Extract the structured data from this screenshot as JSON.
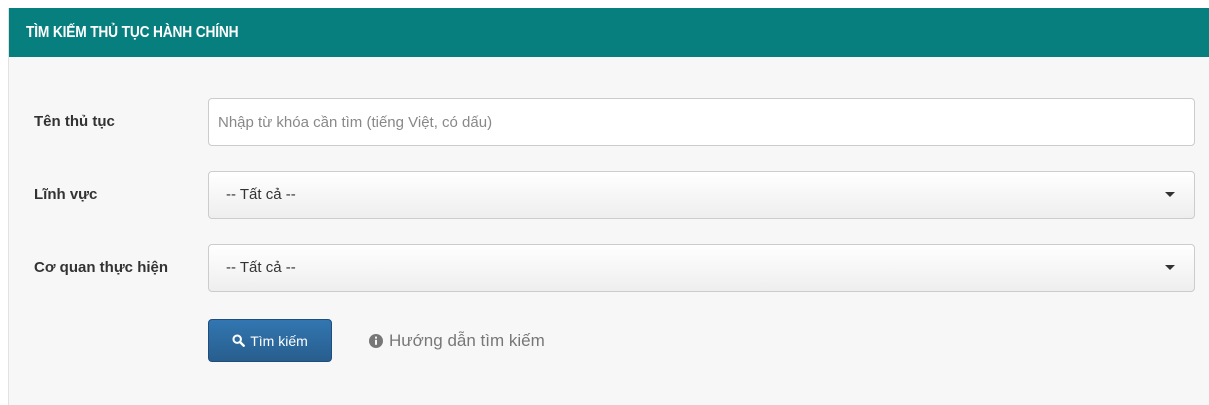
{
  "panel": {
    "title": "TÌM KIẾM THỦ TỤC HÀNH CHÍNH"
  },
  "form": {
    "procedure_name": {
      "label": "Tên thủ tục",
      "value": "",
      "placeholder": "Nhập từ khóa cần tìm (tiếng Việt, có dấu)"
    },
    "field": {
      "label": "Lĩnh vực",
      "selected": "-- Tất cả --"
    },
    "agency": {
      "label": "Cơ quan thực hiện",
      "selected": "-- Tất cả --"
    },
    "search_button": {
      "label": "Tìm kiếm",
      "icon": "search-icon"
    },
    "guide_link": {
      "label": "Hướng dẫn tìm kiếm",
      "icon": "info-circle-icon"
    }
  },
  "colors": {
    "header_bg": "#077f7f",
    "panel_bg": "#f7f7f7",
    "button_bg": "#2e6da4",
    "link_text": "#777777"
  }
}
